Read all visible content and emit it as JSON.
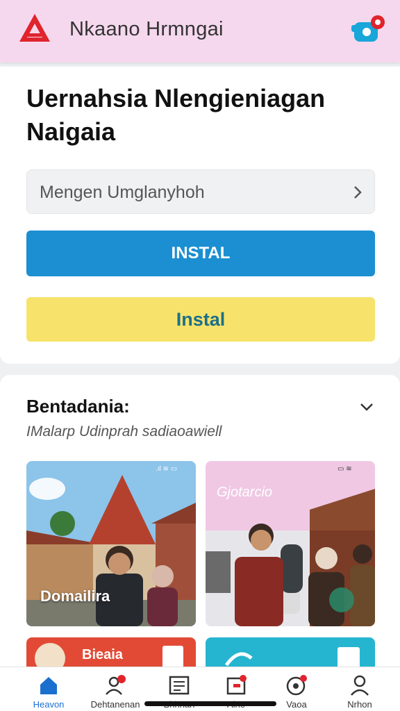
{
  "header": {
    "title": "Nkaano Hrmngai"
  },
  "hero": {
    "headline": "Uernahsia Nlengieniagan Naigaia",
    "select": {
      "value": "Mengen  Umglanyhoh"
    },
    "primary_button": "INSTAL",
    "secondary_button": "Instal"
  },
  "section": {
    "title": "Bentadania:",
    "subtitle": "IMalarp Udinprah sadiaoawiell",
    "cards": [
      {
        "caption": "Domailira"
      },
      {
        "caption": "Gjotarcio"
      },
      {
        "caption": "Bieaia"
      },
      {
        "caption": ""
      }
    ]
  },
  "nav": {
    "items": [
      {
        "label": "Heavon",
        "icon": "home-icon",
        "active": true
      },
      {
        "label": "Dehtanenan",
        "icon": "people-icon"
      },
      {
        "label": "Bhhnan",
        "icon": "news-icon"
      },
      {
        "label": "Aine",
        "icon": "message-icon"
      },
      {
        "label": "Vaoa",
        "icon": "eye-icon"
      },
      {
        "label": "Nrhon",
        "icon": "profile-icon"
      }
    ]
  },
  "colors": {
    "header_bg": "#f6d8ee",
    "accent": "#1b8fd1",
    "yellow": "#f7e36b",
    "logo_red": "#e0242c",
    "notif_blue": "#19a6d9"
  }
}
